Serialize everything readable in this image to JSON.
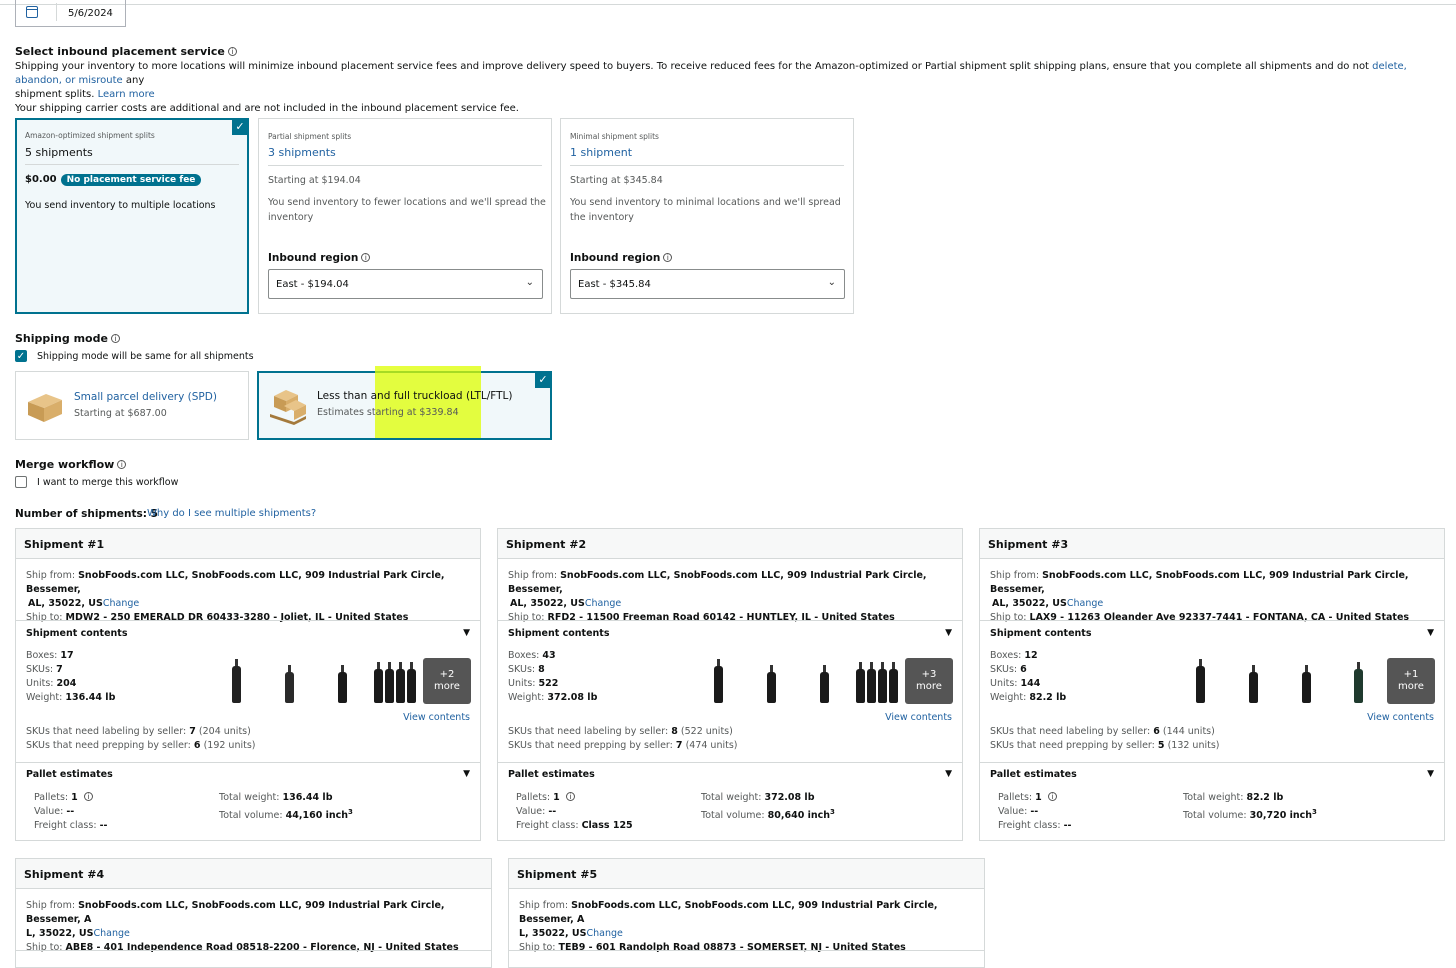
{
  "date": "5/6/2024",
  "placement": {
    "title": "Select inbound placement service",
    "desc1": "Shipping your inventory to more locations will minimize inbound placement service fees and improve delivery speed to buyers. To receive reduced fees for the Amazon-optimized or Partial shipment split shipping plans, ensure that you complete all shipments and do not ",
    "desc_link": "delete, abandon, or misroute",
    "desc1b": " any",
    "desc2": "shipment splits. ",
    "learn_more": "Learn more",
    "desc3": "Your shipping carrier costs are additional and are not included in the inbound placement service fee.",
    "options": [
      {
        "label": "Amazon-optimized shipment splits",
        "count": "5 shipments",
        "price": "$0.00",
        "badge": "No placement service fee",
        "text": "You send inventory to multiple locations"
      },
      {
        "label": "Partial shipment splits",
        "count": "3 shipments",
        "price": "Starting at $194.04",
        "text1": "You send inventory to fewer locations and we'll spread the",
        "text2": "inventory",
        "region_label": "Inbound region",
        "region_value": "East - $194.04"
      },
      {
        "label": "Minimal shipment splits",
        "count": "1 shipment",
        "price": "Starting at $345.84",
        "text1": "You send inventory to minimal locations and we'll spread",
        "text2": "the inventory",
        "region_label": "Inbound region",
        "region_value": "East - $345.84"
      }
    ]
  },
  "shipping_mode": {
    "title": "Shipping mode",
    "same_label": "Shipping mode will be same for all shipments",
    "spd_title": "Small parcel delivery (SPD)",
    "spd_price": "Starting at $687.00",
    "ltl_title": "Less than and full truckload (LTL/FTL)",
    "ltl_price": "Estimates starting at $339.84"
  },
  "merge": {
    "title": "Merge workflow",
    "label": "I want to merge this workflow"
  },
  "num_shipments": {
    "label": "Number of shipments: 5",
    "link": "Why do I see multiple shipments?"
  },
  "common": {
    "ship_from_label": "Ship from:",
    "ship_to_label": "Ship to:",
    "ship_from": "SnobFoods.com LLC, SnobFoods.com LLC, 909 Industrial Park Circle, Bessemer,",
    "ship_from2": "AL, 35022, US",
    "change": "Change",
    "contents": "Shipment contents",
    "boxes": "Boxes:",
    "skus": "SKUs:",
    "units": "Units:",
    "weight": "Weight:",
    "view_contents": "View contents",
    "labeling": "SKUs that need labeling by seller:",
    "prepping": "SKUs that need prepping by seller:",
    "pallet": "Pallet estimates",
    "pallets": "Pallets:",
    "value": "Value:",
    "freight": "Freight class:",
    "total_weight": "Total weight:",
    "total_volume": "Total volume:"
  },
  "shipments": [
    {
      "title": "Shipment #1",
      "to": "MDW2 - 250 EMERALD DR 60433-3280 - Joliet, IL - United States",
      "boxes": "17",
      "skus": "7",
      "units": "204",
      "weight": "136.44 lb",
      "more": "+2",
      "more2": "more",
      "labeling": "7",
      "labeling_units": "(204 units)",
      "prepping": "6",
      "prepping_units": "(192 units)",
      "pallets": "1",
      "value": "--",
      "freight": "--",
      "total_weight": "136.44 lb",
      "total_volume": "44,160 inch"
    },
    {
      "title": "Shipment #2",
      "to": "RFD2 - 11500 Freeman Road 60142 - HUNTLEY, IL - United States",
      "boxes": "43",
      "skus": "8",
      "units": "522",
      "weight": "372.08 lb",
      "more": "+3",
      "more2": "more",
      "labeling": "8",
      "labeling_units": "(522 units)",
      "prepping": "7",
      "prepping_units": "(474 units)",
      "pallets": "1",
      "value": "--",
      "freight": "Class 125",
      "total_weight": "372.08 lb",
      "total_volume": "80,640 inch"
    },
    {
      "title": "Shipment #3",
      "to": "LAX9 - 11263 Oleander Ave 92337-7441 - FONTANA, CA - United States",
      "boxes": "12",
      "skus": "6",
      "units": "144",
      "weight": "82.2 lb",
      "more": "+1",
      "more2": "more",
      "labeling": "6",
      "labeling_units": "(144 units)",
      "prepping": "5",
      "prepping_units": "(132 units)",
      "pallets": "1",
      "value": "--",
      "freight": "--",
      "total_weight": "82.2 lb",
      "total_volume": "30,720 inch"
    },
    {
      "title": "Shipment #4",
      "from": "SnobFoods.com LLC, SnobFoods.com LLC, 909 Industrial Park Circle, Bessemer, A",
      "from2": "L, 35022, US",
      "to": "ABE8 - 401 Independence Road 08518-2200 - Florence, NJ - United States"
    },
    {
      "title": "Shipment #5",
      "from": "SnobFoods.com LLC, SnobFoods.com LLC, 909 Industrial Park Circle, Bessemer, A",
      "from2": "L, 35022, US",
      "to": "TEB9 - 601 Randolph Road 08873 - SOMERSET, NJ - United States"
    }
  ],
  "colors": {
    "accent": "#00728f",
    "link": "#2162a1",
    "highlight": "#ddff00"
  }
}
